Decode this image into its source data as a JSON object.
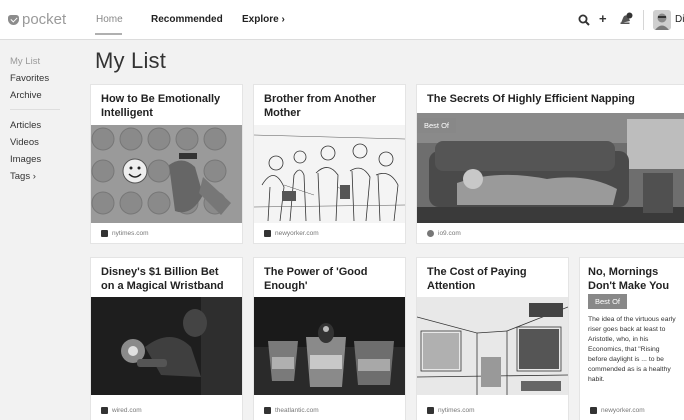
{
  "brand": {
    "name": "pocket"
  },
  "topnav": {
    "home": "Home",
    "recommended": "Recommended",
    "explore": "Explore ›"
  },
  "topright": {
    "add_glyph": "+",
    "user_name": "Die"
  },
  "sidebar": {
    "items": [
      {
        "label": "My List"
      },
      {
        "label": "Favorites"
      },
      {
        "label": "Archive"
      },
      {
        "label": "Articles"
      },
      {
        "label": "Videos"
      },
      {
        "label": "Images"
      },
      {
        "label": "Tags ›"
      }
    ]
  },
  "page": {
    "title": "My List"
  },
  "cards": [
    {
      "title": "How to Be Emotionally Intelligent",
      "source": "nytimes.com",
      "icon": "nytimes-icon"
    },
    {
      "title": "Brother from Another Mother",
      "source": "newyorker.com",
      "icon": "newyorker-icon"
    },
    {
      "title": "The Secrets Of Highly Efficient Napping",
      "source": "io9.com",
      "badge": "Best Of",
      "icon": "io9-icon"
    },
    {
      "title": "Disney's $1 Billion Bet on a Magical Wristband",
      "source": "wired.com",
      "icon": "wired-icon"
    },
    {
      "title": "The Power of 'Good Enough'",
      "source": "theatlantic.com",
      "icon": "theatlantic-icon"
    },
    {
      "title": "The Cost of Paying Attention",
      "source": "nytimes.com",
      "icon": "nytimes-icon"
    },
    {
      "title": "No, Mornings Don't Make You Moral",
      "source": "newyorker.com",
      "badge": "Best Of",
      "excerpt": "The idea of the virtuous early riser goes back at least to Aristotle, who, in his Economics, that \"Rising before daylight is ... to be commended as is a healthy habit.",
      "icon": "newyorker-icon"
    }
  ]
}
